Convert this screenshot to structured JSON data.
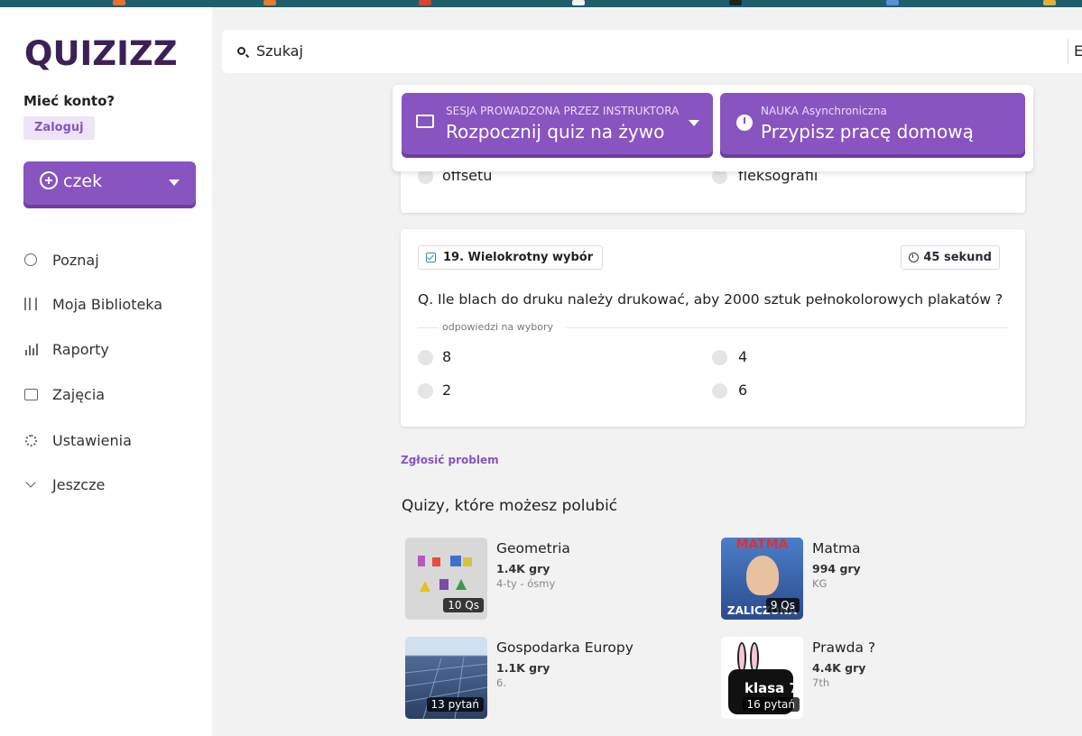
{
  "logo": "QUIZIZZ",
  "sidebar": {
    "account_question": "Mieć konto?",
    "login_label": "Zaloguj",
    "create_label": "czek",
    "nav": [
      {
        "label": "Poznaj",
        "icon": "explore-icon"
      },
      {
        "label": "Moja Biblioteka",
        "icon": "library-icon"
      },
      {
        "label": "Raporty",
        "icon": "reports-icon"
      },
      {
        "label": "Zajęcia",
        "icon": "classes-icon"
      },
      {
        "label": "Ustawienia",
        "icon": "settings-icon"
      },
      {
        "label": "Jeszcze",
        "icon": "chevron-down-icon"
      }
    ]
  },
  "search": {
    "value": "Szukaj",
    "right_text": "E"
  },
  "cta": {
    "live": {
      "small": "SESJA PROWADZONA PRZEZ INSTRUKTORA",
      "big": "Rozpocznij quiz na żywo"
    },
    "homework": {
      "small": "NAUKA Asynchroniczna",
      "big": "Przypisz pracę domową"
    }
  },
  "prev_question": {
    "options": [
      "offsetu",
      "fleksografii"
    ]
  },
  "question": {
    "type_label": "19. Wielokrotny wybór",
    "time_label": "45 sekund",
    "text": "Q. Ile blach do druku należy drukować, aby 2000 sztuk pełnokolorowych plakatów ?",
    "answers_label": "odpowiedzi na wybory",
    "options": [
      "8",
      "4",
      "2",
      "6"
    ]
  },
  "report_label": "Zgłosić problem",
  "recommend": {
    "title": "Quizy, które możesz polubić",
    "quizzes": [
      {
        "name": "Geometria",
        "plays": "1.4K gry",
        "grade": "4-ty - ósmy",
        "qs": "10 Qs"
      },
      {
        "name": "Matma",
        "plays": "994 gry",
        "grade": "KG",
        "qs": "9 Qs",
        "thumb_text_top": "MATMA",
        "thumb_text_bottom": "ZALICZONA"
      },
      {
        "name": "Gospodarka Europy",
        "plays": "1.1K gry",
        "grade": "6.",
        "qs": "13 pytań"
      },
      {
        "name": "Prawda ?",
        "plays": "4.4K gry",
        "grade": "7th",
        "qs": "16 pytań",
        "thumb_text": "klasa 7"
      }
    ]
  },
  "colors": {
    "brand_purple": "#8854c0",
    "logo_dark": "#3b2156"
  }
}
